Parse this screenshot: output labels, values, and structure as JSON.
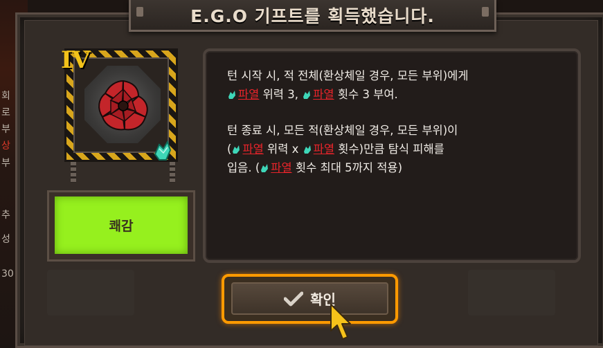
{
  "title": "E.G.O 기프트를 획득했습니다.",
  "gift": {
    "tier": "IV",
    "affinity_label": "쾌감",
    "affinity_color": "#96f01e",
    "frame_color": "#d8a61c"
  },
  "description": {
    "p1_a": "턴 시작 시, 적 전체(환상체일 경우, 모든 부위)에게",
    "p1_kw1": "파열",
    "p1_b": " 위력 3, ",
    "p1_kw2": "파열",
    "p1_c": " 횟수 3 부여.",
    "p2_a": "턴 종료 시, 모든 적(환상체일 경우, 모든 부위)이",
    "p2_b": "(",
    "p2_kw1": "파열",
    "p2_c": " 위력 x ",
    "p2_kw2": "파열",
    "p2_d": " 횟수)만큼 탐식 피해를",
    "p2_e": "입음. (",
    "p2_kw3": "파열",
    "p2_f": " 횟수 최대 5까지 적용)",
    "keyword_color": "#e8242a"
  },
  "confirm_button": {
    "label": "확인",
    "icon": "check-icon",
    "border_color": "#ff9a00"
  },
  "background": {
    "left_texts": [
      "회",
      "로",
      "부",
      "상",
      "부",
      "추",
      "성",
      "30"
    ]
  }
}
